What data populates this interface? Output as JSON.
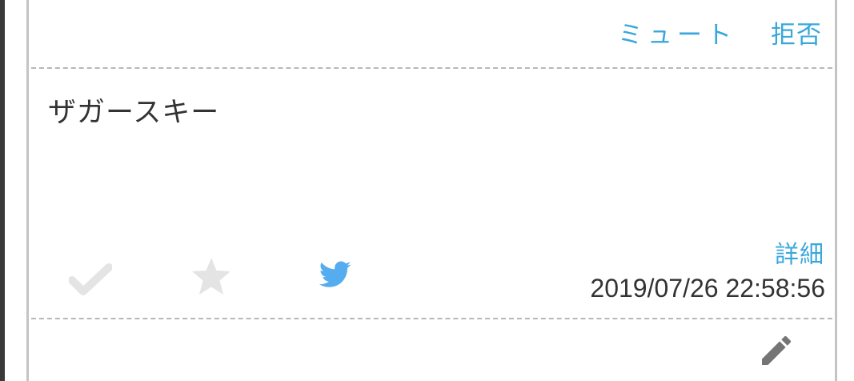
{
  "header": {
    "mute_label": "ミュート",
    "reject_label": "拒否"
  },
  "post": {
    "message": "ザガースキー",
    "detail_label": "詳細",
    "timestamp": "2019/07/26 22:58:56"
  },
  "icons": {
    "check": "check-icon",
    "favorite": "star-icon",
    "share": "twitter-bird-icon",
    "edit": "pencil-icon"
  },
  "colors": {
    "link": "#3aa7dc",
    "twitter": "#55acee",
    "inactive_icon": "#e4e4e4",
    "text": "#333333"
  }
}
